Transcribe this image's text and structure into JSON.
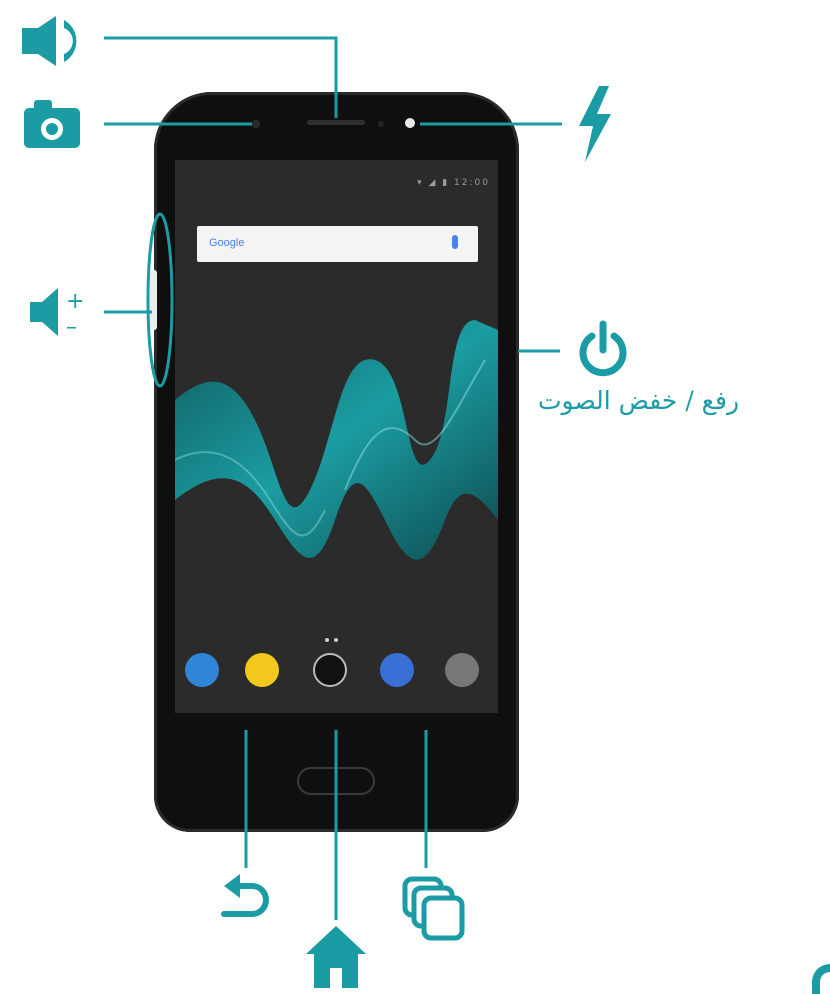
{
  "colors": {
    "accent": "#1b9ca5",
    "phone": "#0f0f0f",
    "screen": "#2b2b2b"
  },
  "labels": {
    "power_caption": "رفع / خفض الصوت",
    "volume_plus": "+",
    "volume_minus": "–"
  },
  "screen": {
    "search_logo": "Google",
    "status": "▾ ◢ ▮ 12:00"
  },
  "icons": [
    "speaker-icon",
    "camera-icon",
    "flash-icon",
    "volume-icon",
    "power-icon",
    "back-icon",
    "home-icon",
    "recent-apps-icon"
  ]
}
